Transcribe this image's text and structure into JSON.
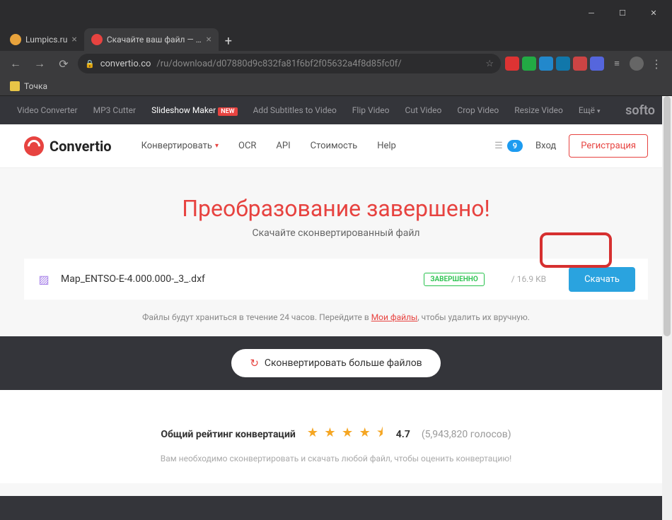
{
  "browser": {
    "tabs": [
      {
        "title": "Lumpics.ru",
        "favColor": "#e8a33c"
      },
      {
        "title": "Скачайте ваш файл — Convertio",
        "favColor": "#e74340"
      }
    ],
    "url_host": "convertio.co",
    "url_path": "/ru/download/d07880d9c832fa81f6bf2f05632a4f8d85fc0f/",
    "bookmark": "Точка"
  },
  "softo": {
    "items": [
      "Video Converter",
      "MP3 Cutter",
      "Slideshow Maker",
      "Add Subtitles to Video",
      "Flip Video",
      "Cut Video",
      "Crop Video",
      "Resize Video",
      "Ещё"
    ],
    "new_badge": "NEW",
    "logo": "softo"
  },
  "nav": {
    "logo": "Convertio",
    "items": [
      "Конвертировать",
      "OCR",
      "API",
      "Стоимость",
      "Help"
    ],
    "credits": "9",
    "login": "Вход",
    "register": "Регистрация"
  },
  "page": {
    "headline": "Преобразование завершено!",
    "subhead": "Скачайте сконвертированный файл",
    "file_name": "Map_ENTSO-E-4.000.000-_3_.dxf",
    "status": "ЗАВЕРШЕННО",
    "size": "/ 16.9 KB",
    "download": "Скачать",
    "note_pre": "Файлы будут храниться в течение 24 часов. Перейдите в ",
    "note_link": "Мои файлы",
    "note_post": ", чтобы удалить их вручную.",
    "more": "Сконвертировать больше файлов"
  },
  "rating": {
    "label": "Общий рейтинг конвертаций",
    "stars": "★ ★ ★ ★ ⯨",
    "value": "4.7",
    "count": "(5,943,820 голосов)",
    "note": "Вам необходимо сконвертировать и скачать любой файл, чтобы оценить конвертацию!"
  }
}
